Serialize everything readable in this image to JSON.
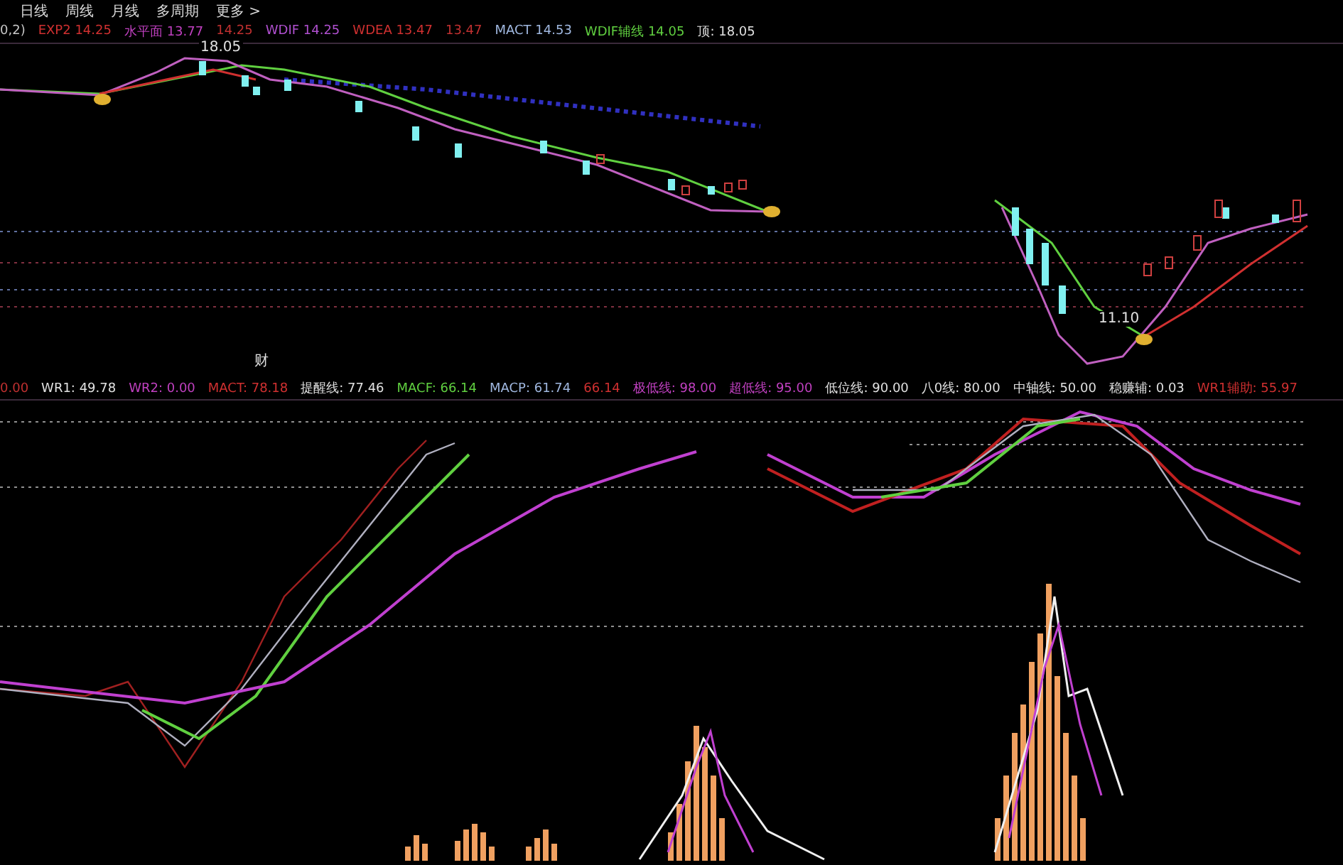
{
  "period_tabs": [
    {
      "label": "日线"
    },
    {
      "label": "周线"
    },
    {
      "label": "月线"
    },
    {
      "label": "多周期"
    },
    {
      "label": "更多 >"
    }
  ],
  "price_legend": [
    {
      "text": "0,2)",
      "color": "#c8c8c8"
    },
    {
      "text": "EXP2 14.25",
      "color": "#d03030"
    },
    {
      "text": "水平面 13.77",
      "color": "#c040c0"
    },
    {
      "text": "14.25",
      "color": "#c03030"
    },
    {
      "text": "WDIF 14.25",
      "color": "#b050d0"
    },
    {
      "text": "WDEA 13.47",
      "color": "#d03030"
    },
    {
      "text": "13.47",
      "color": "#c03030"
    },
    {
      "text": "MACT 14.53",
      "color": "#a0b8e0"
    },
    {
      "text": "WDIF辅线 14.05",
      "color": "#60d040"
    },
    {
      "text": "顶: 18.05",
      "color": "#e0e0e0"
    }
  ],
  "price_chart": {
    "peak_label": "18.05",
    "trough_label": "11.10",
    "marker": "财"
  },
  "indicator_legend": [
    {
      "text": "0.00",
      "color": "#c03030"
    },
    {
      "text": "WR1: 49.78",
      "color": "#e0e0e0"
    },
    {
      "text": "WR2: 0.00",
      "color": "#c040c0"
    },
    {
      "text": "MACT: 78.18",
      "color": "#d03030"
    },
    {
      "text": "提醒线: 77.46",
      "color": "#e0e0e0"
    },
    {
      "text": "MACF: 66.14",
      "color": "#60d040"
    },
    {
      "text": "MACP: 61.74",
      "color": "#a0b8e0"
    },
    {
      "text": "66.14",
      "color": "#d03030"
    },
    {
      "text": "极低线: 98.00",
      "color": "#c040c0"
    },
    {
      "text": "超低线: 95.00",
      "color": "#c040c0"
    },
    {
      "text": "低位线: 90.00",
      "color": "#e0e0e0"
    },
    {
      "text": "八0线: 80.00",
      "color": "#e0e0e0"
    },
    {
      "text": "中轴线: 50.00",
      "color": "#e0e0e0"
    },
    {
      "text": "稳赚辅: 0.03",
      "color": "#e0e0e0"
    },
    {
      "text": "WR1辅助: 55.97",
      "color": "#d03030"
    }
  ]
}
